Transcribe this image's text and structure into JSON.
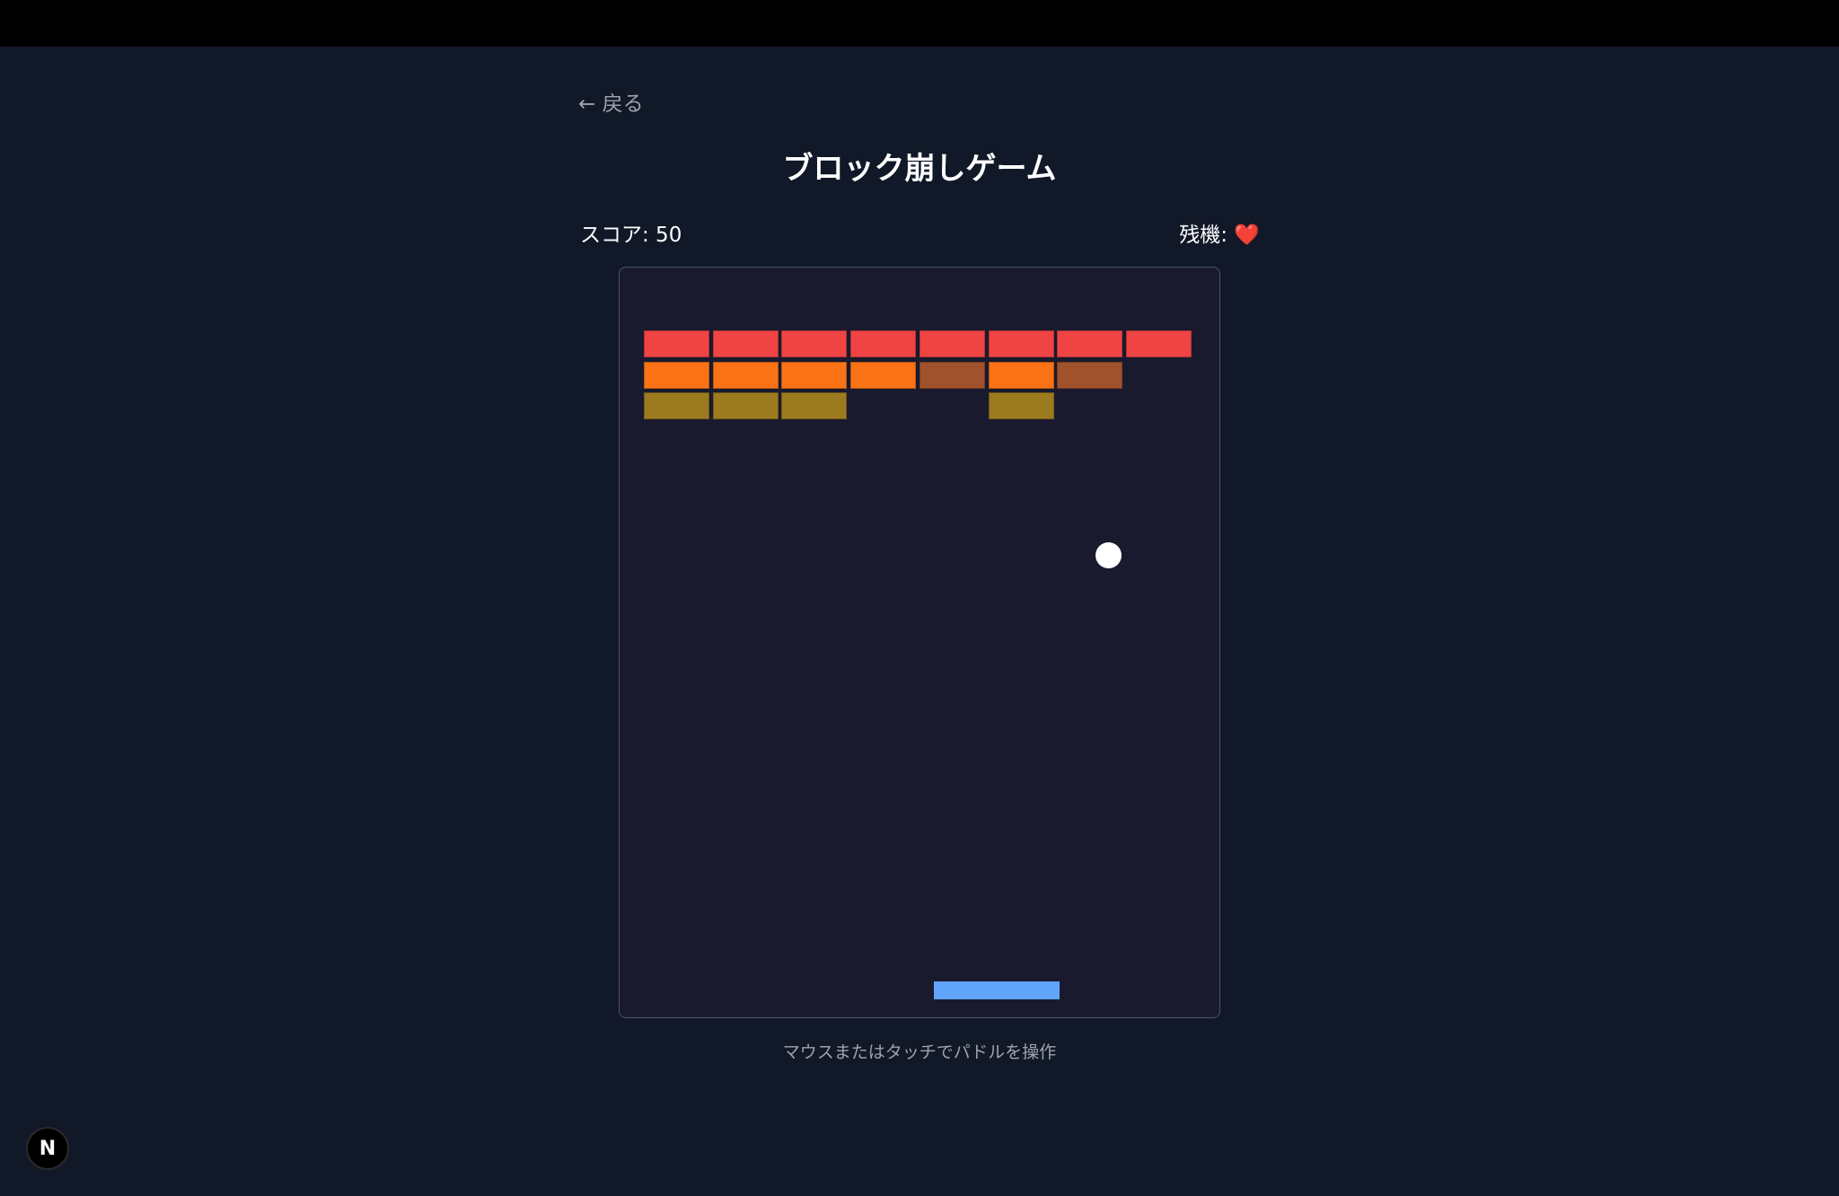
{
  "nav": {
    "back_label": "← 戻る"
  },
  "title": "ブロック崩しゲーム",
  "hud": {
    "score_label": "スコア: 50",
    "lives_label": "残機: ",
    "lives_icon": "❤️",
    "lives_count": 1
  },
  "game": {
    "bricks": [
      {
        "row": 0,
        "cols": [
          0,
          1,
          2,
          3,
          4,
          5,
          6,
          7
        ],
        "color": "#ef4444"
      },
      {
        "row": 1,
        "cols": [
          0,
          1,
          2,
          3,
          5
        ],
        "color": "#f97316"
      },
      {
        "row": 1,
        "cols": [
          4,
          6
        ],
        "color": "#a0522d"
      },
      {
        "row": 2,
        "cols": [
          0,
          1,
          2,
          5
        ],
        "color": "#9b7a20"
      }
    ],
    "ball_color": "#ffffff",
    "paddle_color": "#60a5fa"
  },
  "instructions": "マウスまたはタッチでパドルを操作",
  "dev_badge": {
    "label": "N",
    "icon": "nextjs-icon"
  }
}
